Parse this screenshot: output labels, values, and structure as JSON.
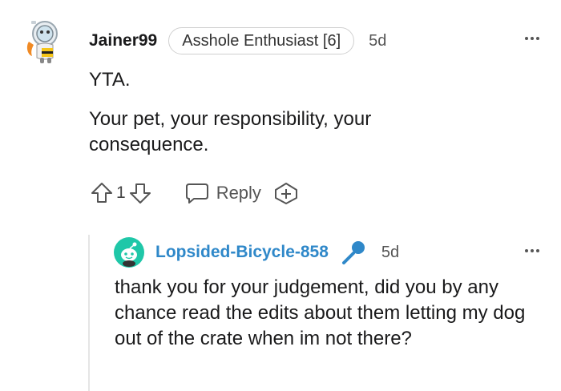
{
  "comment": {
    "username": "Jainer99",
    "flair": "Asshole Enthusiast [6]",
    "time": "5d",
    "verdict": "YTA.",
    "paragraph": "Your pet, your responsibility, your consequence.",
    "vote_count": "1",
    "reply_label": "Reply",
    "icons": [
      "snoo-avatar-icon",
      "more-options-icon",
      "upvote-icon",
      "downvote-icon",
      "reply-bubble-icon",
      "award-icon"
    ]
  },
  "reply": {
    "username": "Lopsided-Bicycle-858",
    "time": "5d",
    "text": "thank you for your judgement, did you by any chance read the edits about them letting my dog out of the crate when im not there?",
    "icons": [
      "snoo-avatar-icon",
      "op-microphone-icon",
      "more-options-icon"
    ]
  },
  "colors": {
    "text": "#1a1a1b",
    "op_username": "#2f88c9",
    "reply_avatar": "#1fc7a8",
    "muted": "#555555"
  }
}
